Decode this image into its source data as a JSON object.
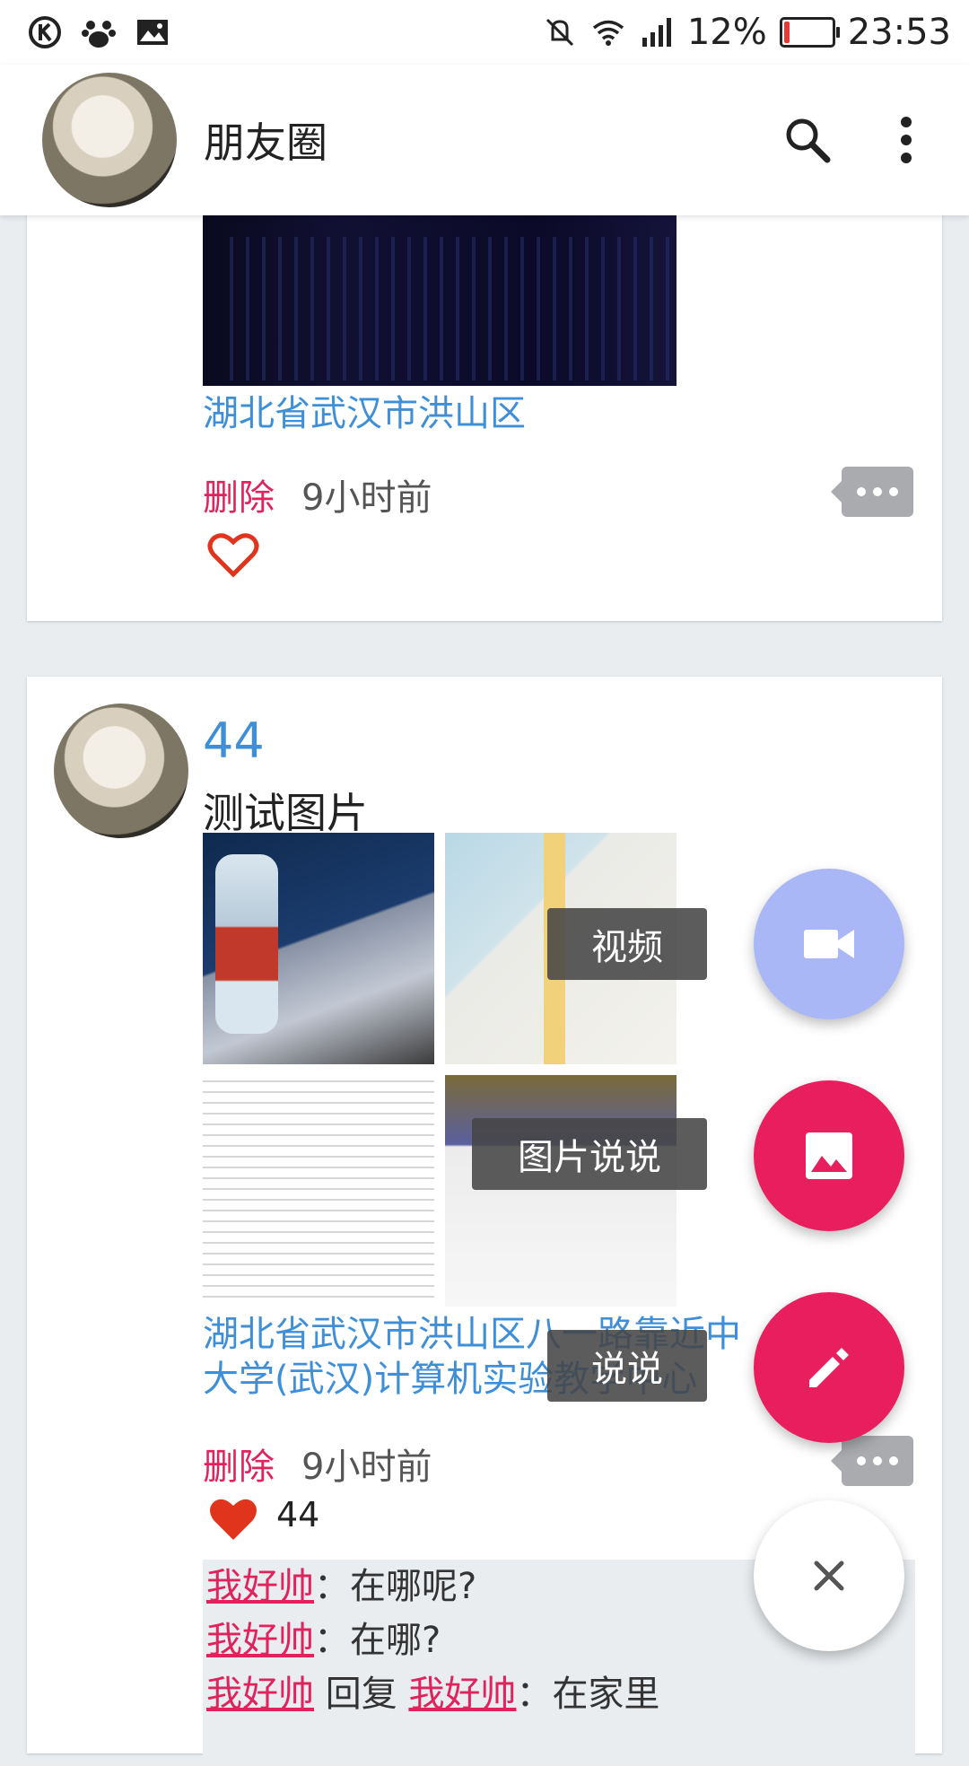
{
  "status_bar": {
    "left_icons": [
      "k-app-icon",
      "baidu-paw-icon",
      "image-icon"
    ],
    "right_icons": [
      "mute-icon",
      "wifi-icon",
      "signal-icon"
    ],
    "battery": "12%",
    "battery_level": 0.12,
    "time": "23:53"
  },
  "app_bar": {
    "title": "朋友圈",
    "search_icon": "search-icon",
    "menu_icon": "more-vert-icon"
  },
  "posts": [
    {
      "location": "湖北省武汉市洪山区",
      "delete_label": "删除",
      "time": "9小时前",
      "liked": false
    },
    {
      "author": "44",
      "text": "测试图片",
      "location_line1": "湖北省武汉市洪山区八一路靠近中",
      "location_line2": "大学(武汉)计算机实验教学中心",
      "delete_label": "删除",
      "time": "9小时前",
      "liked": true,
      "like_users": "44",
      "comments": [
        {
          "user": "我好帅",
          "sep": "：",
          "text": "在哪呢?"
        },
        {
          "user": "我好帅",
          "sep": "：",
          "text": "在哪?"
        },
        {
          "user": "我好帅",
          "reply_word": "回复",
          "reply_to": "我好帅",
          "sep": "：",
          "text": "在家里"
        }
      ]
    }
  ],
  "fab_menu": {
    "video_label": "视频",
    "image_label": "图片说说",
    "text_label": "说说",
    "colors": {
      "video": "#a9b7f7",
      "primary": "#e91e5e",
      "close": "#ffffff"
    }
  }
}
